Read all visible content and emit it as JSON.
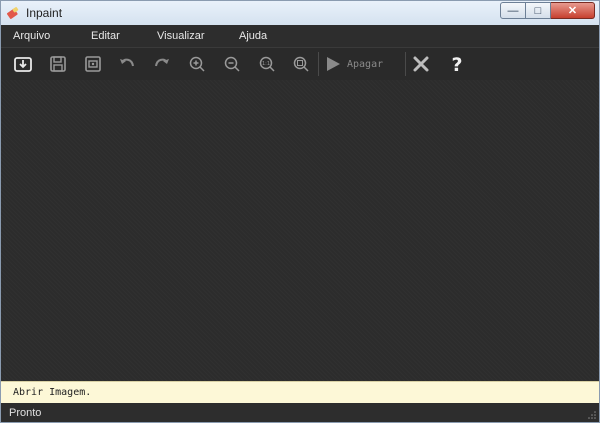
{
  "window": {
    "title": "Inpaint"
  },
  "menu": {
    "items": [
      "Arquivo",
      "Editar",
      "Visualizar",
      "Ajuda"
    ]
  },
  "toolbar": {
    "buttons": [
      "open-icon",
      "save-icon",
      "save-as-icon",
      "undo-icon",
      "redo-icon",
      "zoom-in-icon",
      "zoom-out-icon",
      "zoom-actual-icon",
      "zoom-fit-icon"
    ],
    "erase_label": "Apagar"
  },
  "hint": {
    "text": "Abrir Imagem."
  },
  "status": {
    "text": "Pronto"
  },
  "colors": {
    "accent": "#2b2b2b",
    "hint_bg": "#fdf8d7",
    "close_button": "#c7402f"
  }
}
